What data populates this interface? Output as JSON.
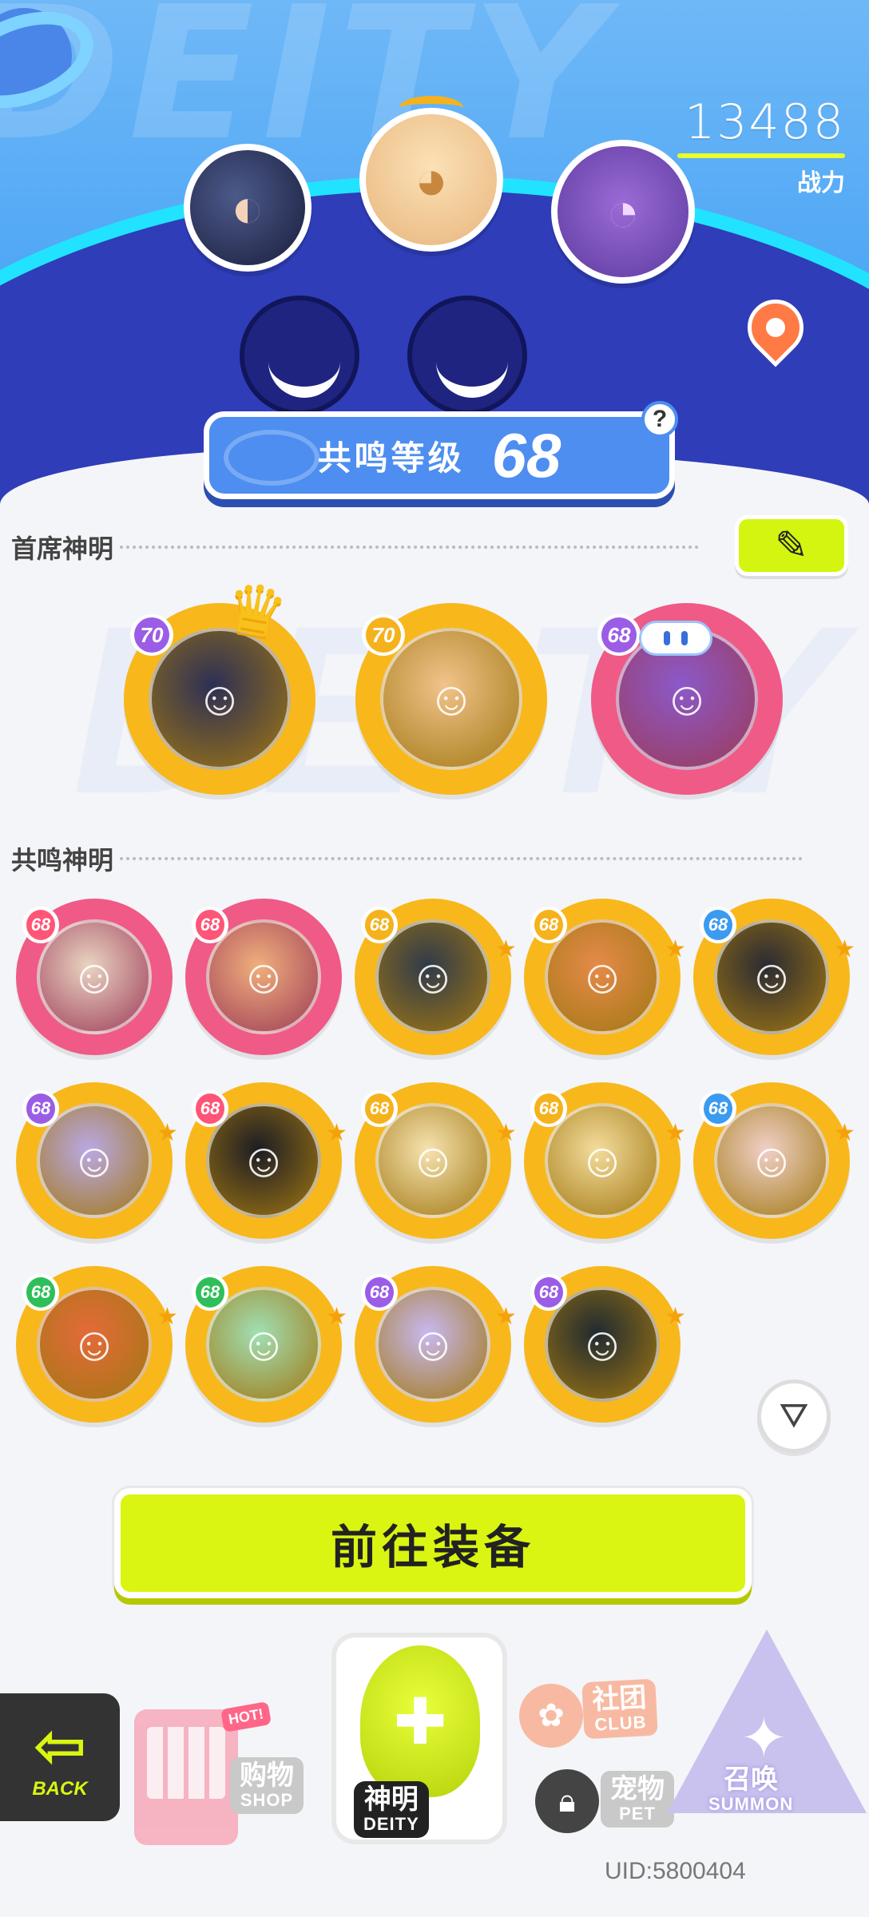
{
  "header": {
    "bg_text": "DEITY",
    "combat_power": {
      "value": "13488",
      "label": "战力"
    },
    "resonance_level": {
      "label": "共鸣等级",
      "value": "68"
    },
    "help_symbol": "?"
  },
  "lead_section": {
    "title": "首席神明",
    "deities": [
      {
        "level": "70",
        "frame": "gold",
        "badge_color": "#9b5de5"
      },
      {
        "level": "70",
        "frame": "gold",
        "badge_color": "#f5b21c"
      },
      {
        "level": "68",
        "frame": "pink",
        "badge_color": "#9b5de5"
      }
    ]
  },
  "resonance_section": {
    "title": "共鸣神明",
    "deities": [
      {
        "level": "68",
        "frame": "pink",
        "badge_color": "#ff5577"
      },
      {
        "level": "68",
        "frame": "pink",
        "badge_color": "#ff5577"
      },
      {
        "level": "68",
        "frame": "gold",
        "badge_color": "#f5b21c"
      },
      {
        "level": "68",
        "frame": "gold",
        "badge_color": "#f5b21c"
      },
      {
        "level": "68",
        "frame": "gold",
        "badge_color": "#3a9bf0"
      },
      {
        "level": "68",
        "frame": "gold",
        "badge_color": "#9b5de5"
      },
      {
        "level": "68",
        "frame": "gold",
        "badge_color": "#ff5577"
      },
      {
        "level": "68",
        "frame": "gold",
        "badge_color": "#f5b21c"
      },
      {
        "level": "68",
        "frame": "gold",
        "badge_color": "#f5b21c"
      },
      {
        "level": "68",
        "frame": "gold",
        "badge_color": "#3a9bf0"
      },
      {
        "level": "68",
        "frame": "gold",
        "badge_color": "#2fbf5a"
      },
      {
        "level": "68",
        "frame": "gold",
        "badge_color": "#2fbf5a"
      },
      {
        "level": "68",
        "frame": "gold",
        "badge_color": "#9b5de5"
      },
      {
        "level": "68",
        "frame": "gold",
        "badge_color": "#9b5de5"
      }
    ]
  },
  "equip_button": {
    "label": "前往装备"
  },
  "nav": {
    "back": {
      "label": "BACK"
    },
    "shop": {
      "label_cn": "购物",
      "label_en": "SHOP",
      "tag": "HOT!"
    },
    "deity": {
      "label_cn": "神明",
      "label_en": "DEITY"
    },
    "club": {
      "label_cn": "社团",
      "label_en": "CLUB",
      "badge": "CLUB"
    },
    "pet": {
      "label_cn": "宠物",
      "label_en": "PET"
    },
    "summon": {
      "label_cn": "召唤",
      "label_en": "SUMMON"
    }
  },
  "uid": "UID:5800404",
  "colors": {
    "accent_lime": "#d9f511",
    "header_blue": "#4fa7f5",
    "frame_gold": "#f8b81c",
    "frame_pink": "#f05a86"
  }
}
